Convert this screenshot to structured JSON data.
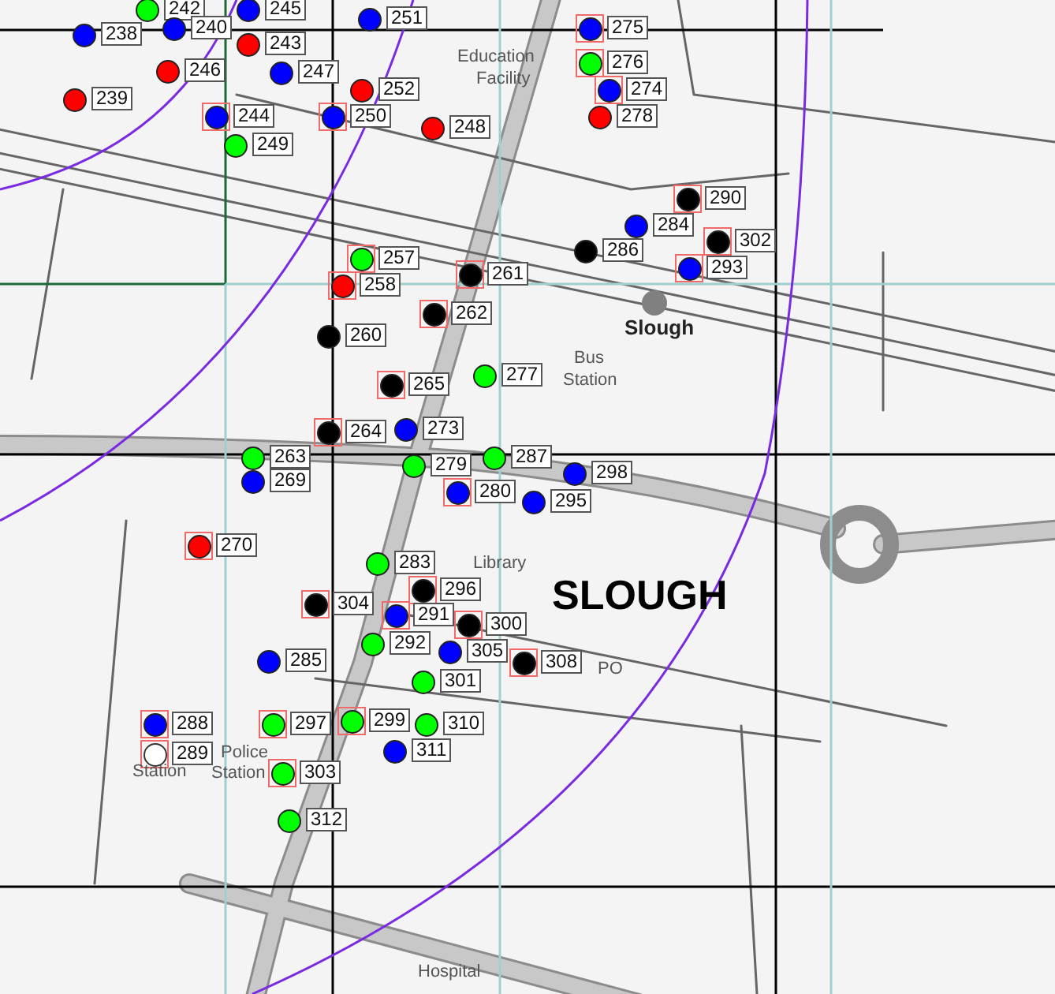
{
  "map": {
    "markers": [
      {
        "label": "242",
        "color": "#00ff00",
        "highlighted": false
      },
      {
        "label": "238",
        "color": "#0000ff",
        "highlighted": false
      },
      {
        "label": "240",
        "color": "#0000ff",
        "highlighted": false
      },
      {
        "label": "245",
        "color": "#0000ff",
        "highlighted": false
      },
      {
        "label": "251",
        "color": "#0000ff",
        "highlighted": false
      },
      {
        "label": "243",
        "color": "#ff0000",
        "highlighted": false
      },
      {
        "label": "246",
        "color": "#ff0000",
        "highlighted": false
      },
      {
        "label": "247",
        "color": "#0000ff",
        "highlighted": false
      },
      {
        "label": "239",
        "color": "#ff0000",
        "highlighted": false
      },
      {
        "label": "252",
        "color": "#ff0000",
        "highlighted": false
      },
      {
        "label": "244",
        "color": "#0000ff",
        "highlighted": true
      },
      {
        "label": "250",
        "color": "#0000ff",
        "highlighted": true
      },
      {
        "label": "248",
        "color": "#ff0000",
        "highlighted": false
      },
      {
        "label": "249",
        "color": "#00ff00",
        "highlighted": false
      },
      {
        "label": "275",
        "color": "#0000ff",
        "highlighted": true
      },
      {
        "label": "276",
        "color": "#00ff00",
        "highlighted": true
      },
      {
        "label": "274",
        "color": "#0000ff",
        "highlighted": true
      },
      {
        "label": "278",
        "color": "#ff0000",
        "highlighted": false
      },
      {
        "label": "290",
        "color": "#000000",
        "highlighted": true
      },
      {
        "label": "284",
        "color": "#0000ff",
        "highlighted": false
      },
      {
        "label": "302",
        "color": "#000000",
        "highlighted": true
      },
      {
        "label": "286",
        "color": "#000000",
        "highlighted": false
      },
      {
        "label": "293",
        "color": "#0000ff",
        "highlighted": true
      },
      {
        "label": "257",
        "color": "#00ff00",
        "highlighted": true
      },
      {
        "label": "261",
        "color": "#000000",
        "highlighted": true
      },
      {
        "label": "258",
        "color": "#ff0000",
        "highlighted": true
      },
      {
        "label": "262",
        "color": "#000000",
        "highlighted": true
      },
      {
        "label": "260",
        "color": "#000000",
        "highlighted": false
      },
      {
        "label": "277",
        "color": "#00ff00",
        "highlighted": false
      },
      {
        "label": "265",
        "color": "#000000",
        "highlighted": true
      },
      {
        "label": "264",
        "color": "#000000",
        "highlighted": true
      },
      {
        "label": "273",
        "color": "#0000ff",
        "highlighted": false
      },
      {
        "label": "263",
        "color": "#00ff00",
        "highlighted": false
      },
      {
        "label": "279",
        "color": "#00ff00",
        "highlighted": false
      },
      {
        "label": "287",
        "color": "#00ff00",
        "highlighted": false
      },
      {
        "label": "298",
        "color": "#0000ff",
        "highlighted": false
      },
      {
        "label": "269",
        "color": "#0000ff",
        "highlighted": false
      },
      {
        "label": "280",
        "color": "#0000ff",
        "highlighted": true
      },
      {
        "label": "295",
        "color": "#0000ff",
        "highlighted": false
      },
      {
        "label": "270",
        "color": "#ff0000",
        "highlighted": true
      },
      {
        "label": "283",
        "color": "#00ff00",
        "highlighted": false
      },
      {
        "label": "296",
        "color": "#000000",
        "highlighted": true
      },
      {
        "label": "304",
        "color": "#000000",
        "highlighted": true
      },
      {
        "label": "291",
        "color": "#0000ff",
        "highlighted": true
      },
      {
        "label": "300",
        "color": "#000000",
        "highlighted": true
      },
      {
        "label": "292",
        "color": "#00ff00",
        "highlighted": false
      },
      {
        "label": "305",
        "color": "#0000ff",
        "highlighted": false
      },
      {
        "label": "308",
        "color": "#000000",
        "highlighted": true
      },
      {
        "label": "285",
        "color": "#0000ff",
        "highlighted": false
      },
      {
        "label": "301",
        "color": "#00ff00",
        "highlighted": false
      },
      {
        "label": "288",
        "color": "#0000ff",
        "highlighted": true
      },
      {
        "label": "297",
        "color": "#00ff00",
        "highlighted": true
      },
      {
        "label": "299",
        "color": "#00ff00",
        "highlighted": true
      },
      {
        "label": "310",
        "color": "#00ff00",
        "highlighted": false
      },
      {
        "label": "289",
        "color": "#ffffff",
        "highlighted": true
      },
      {
        "label": "311",
        "color": "#0000ff",
        "highlighted": false
      },
      {
        "label": "303",
        "color": "#00ff00",
        "highlighted": true
      },
      {
        "label": "312",
        "color": "#00ff00",
        "highlighted": false
      }
    ],
    "places": [
      {
        "text": "Education",
        "kind": "minor"
      },
      {
        "text": "Facility",
        "kind": "minor"
      },
      {
        "text": "Slough",
        "kind": "station"
      },
      {
        "text": "Bus",
        "kind": "minor"
      },
      {
        "text": "Station",
        "kind": "minor"
      },
      {
        "text": "Library",
        "kind": "minor"
      },
      {
        "text": "SLOUGH",
        "kind": "town"
      },
      {
        "text": "PO",
        "kind": "minor"
      },
      {
        "text": "Police",
        "kind": "minor"
      },
      {
        "text": "Station",
        "kind": "minor"
      },
      {
        "text": "Station",
        "kind": "minor"
      },
      {
        "text": "Hospital",
        "kind": "minor"
      }
    ]
  }
}
